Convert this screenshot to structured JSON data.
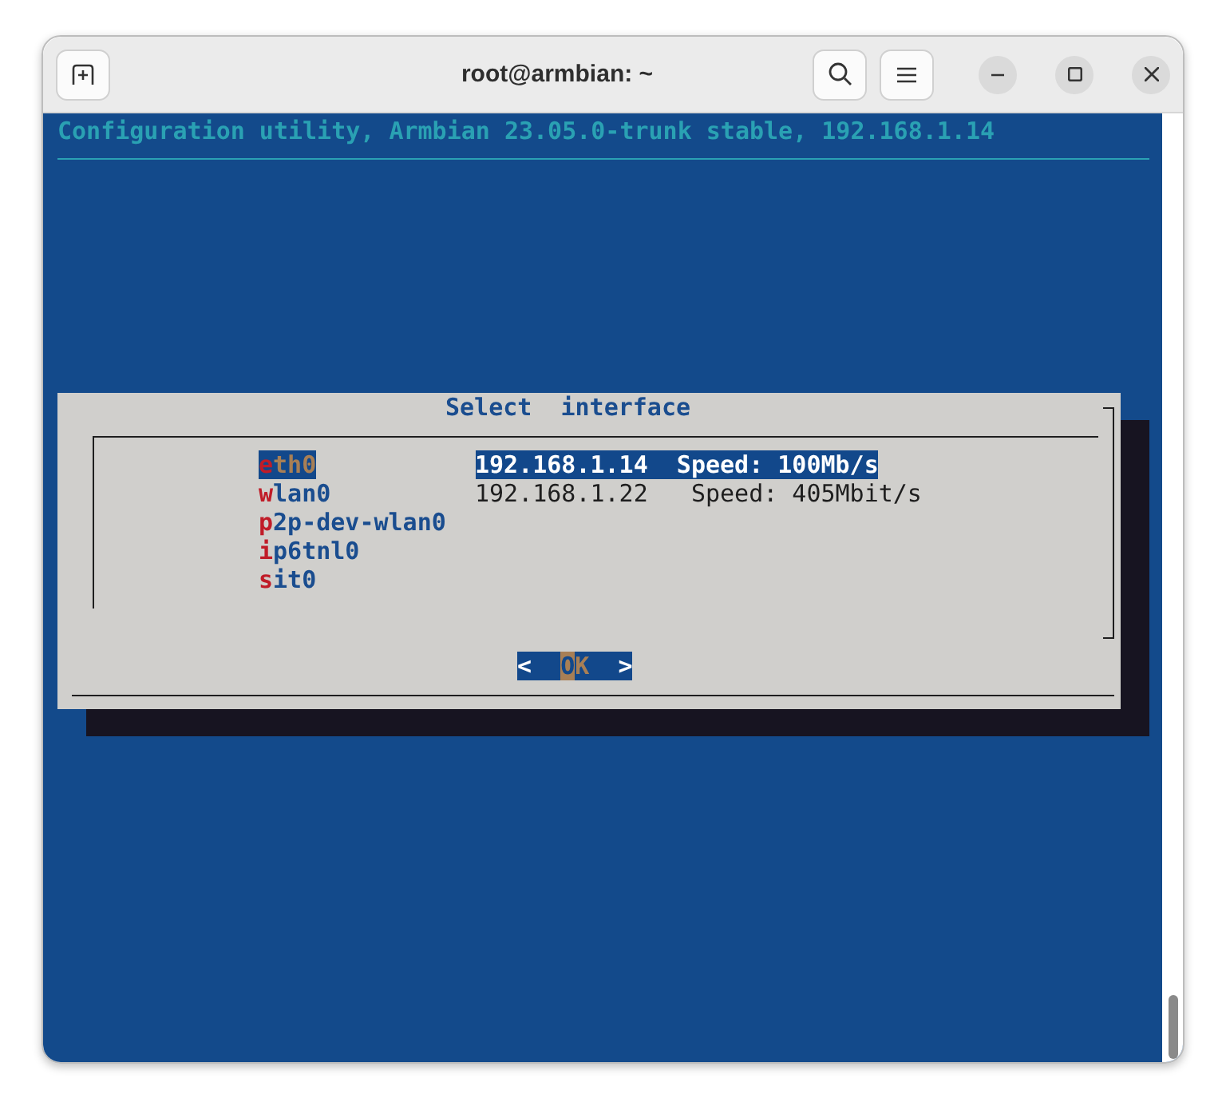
{
  "window": {
    "title": "root@armbian: ~"
  },
  "header": "Configuration utility, Armbian 23.05.0-trunk stable, 192.168.1.14",
  "dialog": {
    "title": "Select  interface",
    "items": [
      {
        "tag": "eth0",
        "description": "192.168.1.14  Speed: 100Mb/s",
        "selected": true
      },
      {
        "tag": "wlan0",
        "description": "192.168.1.22   Speed: 405Mbit/s",
        "selected": false
      },
      {
        "tag": "p2p-dev-wlan0",
        "selected": false
      },
      {
        "tag": "ip6tnl0",
        "selected": false
      },
      {
        "tag": "sit0",
        "selected": false
      }
    ],
    "buttons": [
      {
        "left": "<",
        "label": "OK",
        "right": ">",
        "selected": true
      }
    ]
  }
}
